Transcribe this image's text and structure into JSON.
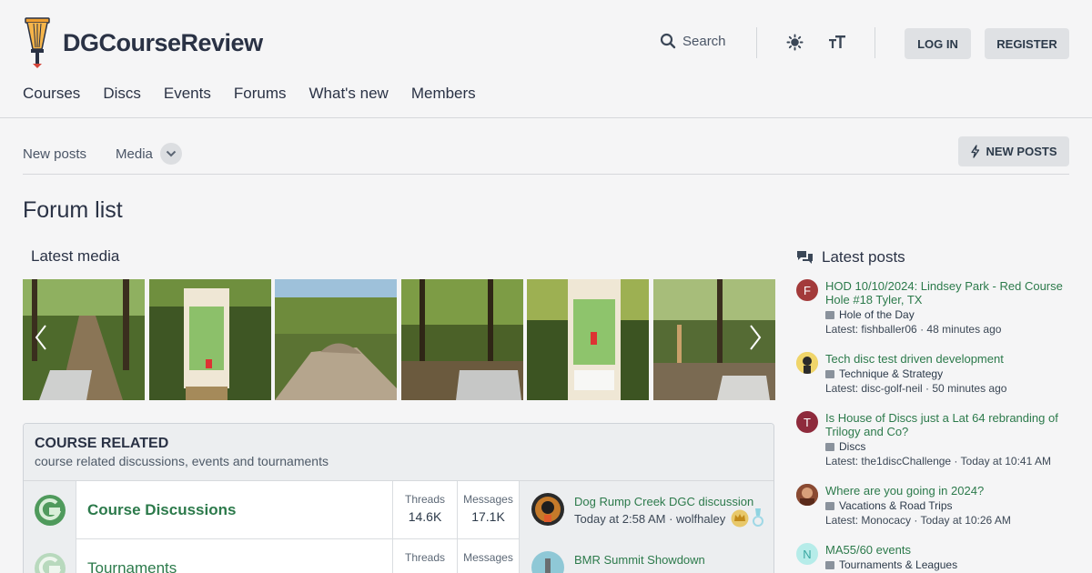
{
  "header": {
    "brand": "DGCourseReview",
    "search_label": "Search",
    "login_label": "LOG IN",
    "register_label": "REGISTER"
  },
  "nav": {
    "items": [
      "Courses",
      "Discs",
      "Events",
      "Forums",
      "What's new",
      "Members"
    ]
  },
  "subnav": {
    "new_posts": "New posts",
    "media": "Media",
    "new_posts_button": "NEW POSTS"
  },
  "page_title": "Forum list",
  "latest_media": {
    "title": "Latest media"
  },
  "course_related": {
    "title": "COURSE RELATED",
    "description": "course related discussions, events and tournaments",
    "forums": [
      {
        "name": "Course Discussions",
        "threads_label": "Threads",
        "threads": "14.6K",
        "messages_label": "Messages",
        "messages": "17.1K",
        "last_title": "Dog Rump Creek DGC discussion",
        "last_meta": "Today at 2:58 AM · wolfhaley"
      },
      {
        "name": "Tournaments",
        "threads_label": "Threads",
        "messages_label": "Messages",
        "last_title": "BMR Summit Showdown"
      }
    ]
  },
  "latest_posts": {
    "title": "Latest posts",
    "posts": [
      {
        "avatar": "F",
        "avatar_color": "#a33a3a",
        "title": "HOD 10/10/2024: Lindsey Park - Red Course Hole #18 Tyler, TX",
        "forum": "Hole of the Day",
        "latest": "Latest: fishballer06 · 48 minutes ago"
      },
      {
        "avatar": "",
        "avatar_color": "#c9a227",
        "title": "Tech disc test driven development",
        "forum": "Technique & Strategy",
        "latest": "Latest: disc-golf-neil · 50 minutes ago"
      },
      {
        "avatar": "T",
        "avatar_color": "#8e2a3c",
        "title": "Is House of Discs just a Lat 64 rebranding of Trilogy and Co?",
        "forum": "Discs",
        "latest": "Latest: the1discChallenge · Today at 10:41 AM"
      },
      {
        "avatar": "",
        "avatar_color": "#7a3b2a",
        "title": "Where are you going in 2024?",
        "forum": "Vacations & Road Trips",
        "latest": "Latest: Monocacy · Today at 10:26 AM"
      },
      {
        "avatar": "N",
        "avatar_color": "#9fe3e0",
        "title": "MA55/60 events",
        "forum": "Tournaments & Leagues",
        "latest": ""
      }
    ]
  },
  "colors": {
    "accent_green": "#2c7a4b",
    "button_grey": "#dfe1e4",
    "background": "#f5f5f6"
  }
}
